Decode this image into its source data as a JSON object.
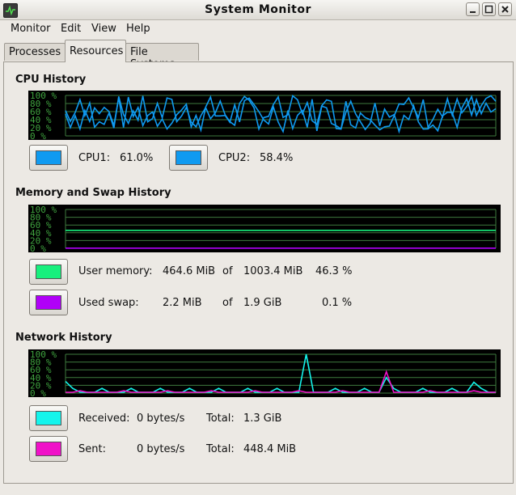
{
  "window": {
    "title": "System Monitor"
  },
  "menu": [
    {
      "label": "Monitor"
    },
    {
      "label": "Edit"
    },
    {
      "label": "View"
    },
    {
      "label": "Help"
    }
  ],
  "tabs": [
    {
      "label": "Processes",
      "active": false
    },
    {
      "label": "Resources",
      "active": true
    },
    {
      "label": "File Systems",
      "active": false
    }
  ],
  "cpu": {
    "title": "CPU History",
    "axis_labels": [
      "100 %",
      "80 %",
      "60 %",
      "40 %",
      "20 %",
      "0 %"
    ],
    "cpu1": {
      "label": "CPU1:",
      "value": "61.0%",
      "color": "#0f9af0"
    },
    "cpu2": {
      "label": "CPU2:",
      "value": "58.4%",
      "color": "#0f9af0"
    }
  },
  "memory": {
    "title": "Memory and Swap History",
    "axis_labels": [
      "100 %",
      "80 %",
      "60 %",
      "40 %",
      "20 %",
      "0 %"
    ],
    "user": {
      "label": "User memory:",
      "used": "464.6 MiB",
      "of": "of",
      "total": "1003.4 MiB",
      "percent": "46.3 %",
      "color": "#17f07d"
    },
    "swap": {
      "label": "Used swap:",
      "used": "2.2 MiB",
      "of": "of",
      "total": "1.9 GiB",
      "percent": "0.1 %",
      "color": "#b000f8"
    }
  },
  "network": {
    "title": "Network History",
    "axis_labels": [
      "100 %",
      "80 %",
      "60 %",
      "40 %",
      "20 %",
      "0 %"
    ],
    "received": {
      "label": "Received:",
      "rate": "0 bytes/s",
      "total_label": "Total:",
      "total": "1.3 GiB",
      "color": "#14f4ec"
    },
    "sent": {
      "label": "Sent:",
      "rate": "0 bytes/s",
      "total_label": "Total:",
      "total": "448.4 MiB",
      "color": "#f010c8"
    }
  },
  "colors": {
    "grid": "#3e7a3e",
    "axis_text": "#3fa33f",
    "graph_bg": "#000000"
  }
}
